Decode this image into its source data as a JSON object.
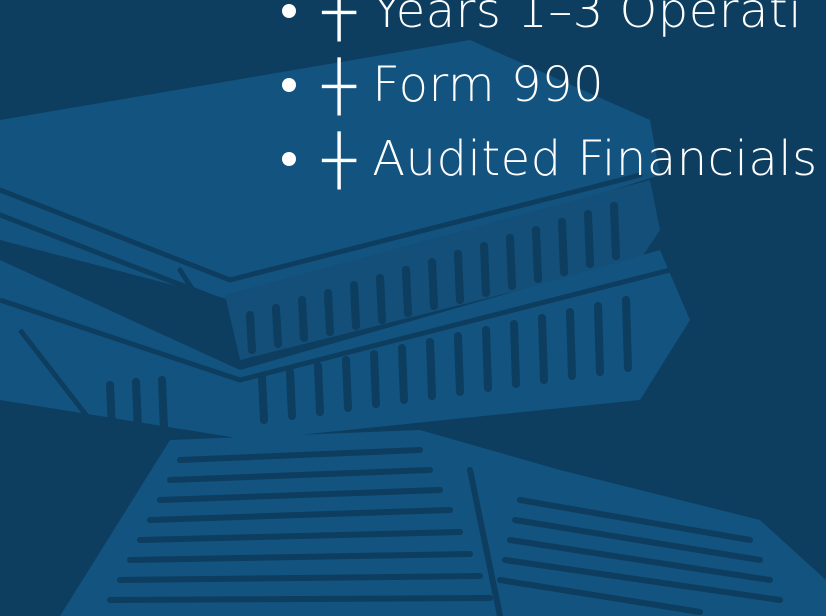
{
  "list": {
    "items": [
      {
        "text": "┼ Years 1–3 Operati"
      },
      {
        "text": "┼ Form 990"
      },
      {
        "text": "┼ Audited Financials"
      }
    ]
  },
  "illustration": {
    "icon": "books-illustration",
    "colors": {
      "background": "#0d3d5f",
      "book_fill": "#13537f",
      "book_line": "#0d3d5f"
    }
  }
}
